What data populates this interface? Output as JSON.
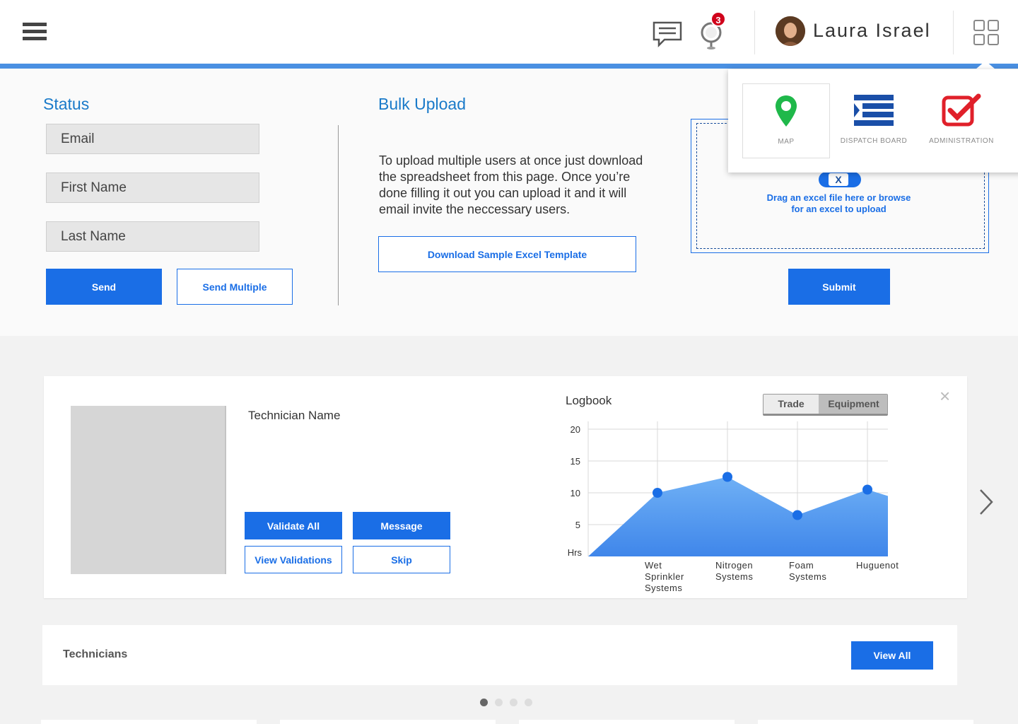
{
  "header": {
    "user_name": "Laura Israel",
    "notification_count": "3",
    "accent_color": "#4a90e2"
  },
  "apps_menu": {
    "items": [
      {
        "label": "MAP",
        "icon": "map-pin-icon"
      },
      {
        "label": "DISPATCH BOARD",
        "icon": "dispatch-board-icon"
      },
      {
        "label": "ADMINISTRATION",
        "icon": "admin-check-icon"
      }
    ]
  },
  "status": {
    "title": "Status",
    "fields": {
      "email": "Email",
      "first_name": "First Name",
      "last_name": "Last Name"
    },
    "send_label": "Send",
    "send_multiple_label": "Send Multiple"
  },
  "bulk_upload": {
    "title": "Bulk Upload",
    "description": "To upload multiple users at once just download the spreadsheet from this page. Once you’re done filling it out you can upload it and it will email invite the neccessary users.",
    "download_label": "Download Sample Excel Template",
    "dropzone_icon_label": "X",
    "dropzone_text_1": "Drag an excel file here or browse",
    "dropzone_text_2": "for an excel to upload",
    "submit_label": "Submit"
  },
  "technician": {
    "name": "Technician Name",
    "validate_all_label": "Validate All",
    "message_label": "Message",
    "view_validations_label": "View Validations",
    "skip_label": "Skip",
    "close_glyph": "×"
  },
  "logbook": {
    "title": "Logbook",
    "toggle": {
      "trade": "Trade",
      "equipment": "Equipment",
      "selected": "Equipment"
    }
  },
  "chart_data": {
    "type": "area",
    "title": "Logbook",
    "categories": [
      "Wet Sprinkler Systems",
      "Nitrogen Systems",
      "Foam Systems",
      "Huguenot"
    ],
    "category_lines": [
      [
        "Wet",
        "Sprinkler",
        "Systems"
      ],
      [
        "Nitrogen",
        "Systems"
      ],
      [
        "Foam",
        "Systems"
      ],
      [
        "Huguenot"
      ]
    ],
    "values": [
      10,
      12.5,
      6.5,
      10.5
    ],
    "start_value": 0,
    "end_value": 9.5,
    "y_ticks": [
      "20",
      "15",
      "10",
      "5"
    ],
    "y_unit": "Hrs",
    "ylim": [
      0,
      20
    ],
    "grid": true,
    "fill_color": "#5a9cf0",
    "point_color": "#1a6ee6"
  },
  "technicians_bar": {
    "title": "Technicians",
    "view_all_label": "View All"
  },
  "pagination": {
    "count": 4,
    "active": 1
  }
}
